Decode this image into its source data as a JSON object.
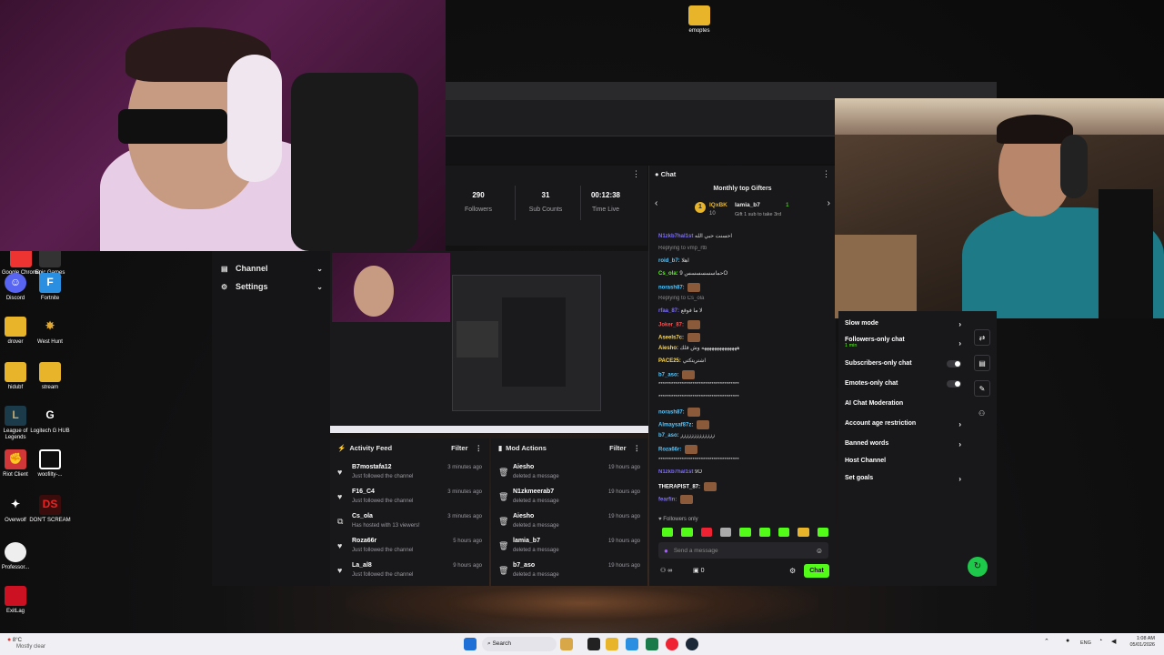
{
  "desktop_icons": [
    {
      "label": "Google Chrome"
    },
    {
      "label": "Epic Games Launcher"
    },
    {
      "label": "Discord"
    },
    {
      "label": "Fortnite"
    },
    {
      "label": "drover"
    },
    {
      "label": "West Hunt"
    },
    {
      "label": "hidubf"
    },
    {
      "label": "stream"
    },
    {
      "label": "League of Legends"
    },
    {
      "label": "Logitech G HUB"
    },
    {
      "label": "Riot Client"
    },
    {
      "label": "woofilty-..."
    },
    {
      "label": "Overwolf"
    },
    {
      "label": "DON'T SCREAM"
    },
    {
      "label": "Professor..."
    },
    {
      "label": "ExitLag"
    },
    {
      "label": "emoptes"
    }
  ],
  "stats": [
    {
      "value": "290",
      "label": "Followers"
    },
    {
      "value": "31",
      "label": "Sub Counts"
    },
    {
      "value": "00:12:38",
      "label": "Time Live"
    }
  ],
  "sidenav": [
    {
      "label": "Channel"
    },
    {
      "label": "Settings"
    }
  ],
  "activity_feed": {
    "title": "Activity Feed",
    "filter": "Filter",
    "items": [
      {
        "name": "B7mostafa12",
        "desc": "Just followed the channel",
        "time": "3 minutes ago"
      },
      {
        "name": "F16_C4",
        "desc": "Just followed the channel",
        "time": "3 minutes ago"
      },
      {
        "name": "Cs_ola",
        "desc": "Has hosted with 13 viewers!",
        "time": "3 minutes ago"
      },
      {
        "name": "Roza66r",
        "desc": "Just followed the channel",
        "time": "5 hours ago"
      },
      {
        "name": "La_al8",
        "desc": "Just followed the channel",
        "time": "9 hours ago"
      }
    ]
  },
  "mod_actions": {
    "title": "Mod Actions",
    "filter": "Filter",
    "items": [
      {
        "name": "Aiesho",
        "desc": "deleted a message",
        "time": "19 hours ago"
      },
      {
        "name": "N1zkmeerab7",
        "desc": "deleted a message",
        "time": "19 hours ago"
      },
      {
        "name": "Aiesho",
        "desc": "deleted a message",
        "time": "19 hours ago"
      },
      {
        "name": "lamia_b7",
        "desc": "deleted a message",
        "time": "19 hours ago"
      },
      {
        "name": "b7_aso",
        "desc": "deleted a message",
        "time": "19 hours ago"
      }
    ]
  },
  "chat": {
    "title": "Chat",
    "gifters_title": "Monthly top Gifters",
    "gifter_1": "IQxBK",
    "gifter_1_count": "10",
    "gifter_2": "lamia_b7",
    "gifter_2_count": "1",
    "gifter_note": "Gift 1 sub to take 3rd",
    "messages": [
      {
        "user": "N1zkb7hal1st",
        "text": "احسنت حبي الله",
        "color": "#7b6cff"
      },
      {
        "user": "",
        "text": "Replying to vmp_rtb",
        "color": "#888"
      },
      {
        "user": "roid_b7:",
        "text": "اهلا",
        "color": "#53c7ff"
      },
      {
        "user": "Cs_ola:",
        "text": "حماسسسسسس 9O",
        "color": "#53fc18"
      },
      {
        "user": "norash87:",
        "text": "",
        "color": "#53c7ff"
      },
      {
        "user": "",
        "text": "Replying to Cs_ola",
        "color": "#888"
      },
      {
        "user": "rfaa_87:",
        "text": "لا ما فوقع",
        "color": "#7b6cff"
      },
      {
        "user": "Joker_87:",
        "text": "",
        "color": "#ff4d4d"
      },
      {
        "user": "Aseels7c:",
        "text": "",
        "color": "#ffd84d"
      },
      {
        "user": "Aiesho:",
        "text": "ههههههههههههههه وش قلك",
        "color": "#ffd84d"
      },
      {
        "user": "PACE25:",
        "text": "اشتريتكتي",
        "color": "#ffd84d"
      },
      {
        "user": "b7_aso:",
        "text": "",
        "color": "#53c7ff"
      },
      {
        "user": "",
        "text": "**************************************",
        "color": "#ddd"
      },
      {
        "user": "",
        "text": "**************************************",
        "color": "#ddd"
      },
      {
        "user": "norash87:",
        "text": "",
        "color": "#53c7ff"
      },
      {
        "user": "Almaysaf87z:",
        "text": "",
        "color": "#53c7ff"
      },
      {
        "user": "b7_aso:",
        "text": "ززززززززززززز",
        "color": "#53c7ff"
      },
      {
        "user": "Roza66r:",
        "text": "",
        "color": "#53c7ff"
      },
      {
        "user": "",
        "text": "**************************************",
        "color": "#ddd"
      },
      {
        "user": "N1zkb7hal1st",
        "text": "9O",
        "color": "#7b6cff"
      },
      {
        "user": "THERAPIST_87:",
        "text": "",
        "color": "#ffffff"
      },
      {
        "user": "fearfin:",
        "text": "",
        "color": "#7b6cff"
      }
    ],
    "followers_only": "Followers only",
    "input_placeholder": "Send a message",
    "count": "0",
    "send_label": "Chat"
  },
  "mod_settings": [
    {
      "label": "Slow mode",
      "type": "chev"
    },
    {
      "label": "Followers-only chat",
      "sub": "1 min",
      "type": "chev"
    },
    {
      "label": "Subscribers-only chat",
      "type": "toggle"
    },
    {
      "label": "Emotes-only chat",
      "type": "toggle"
    },
    {
      "label": "AI Chat Moderation",
      "type": "none"
    },
    {
      "label": "Account age restriction",
      "type": "chev"
    },
    {
      "label": "Banned words",
      "type": "chev"
    },
    {
      "label": "Host Channel",
      "type": "none"
    },
    {
      "label": "Set goals",
      "type": "chev"
    }
  ],
  "taskbar": {
    "weather_temp": "8°C",
    "weather_desc": "Mostly clear",
    "search": "Search",
    "lang": "ENG",
    "time": "1:08 AM",
    "date": "05/01/2026"
  },
  "colors": {
    "accent": "#53fc18",
    "panel": "#18181b",
    "taskbar": "#f0f0f4"
  }
}
